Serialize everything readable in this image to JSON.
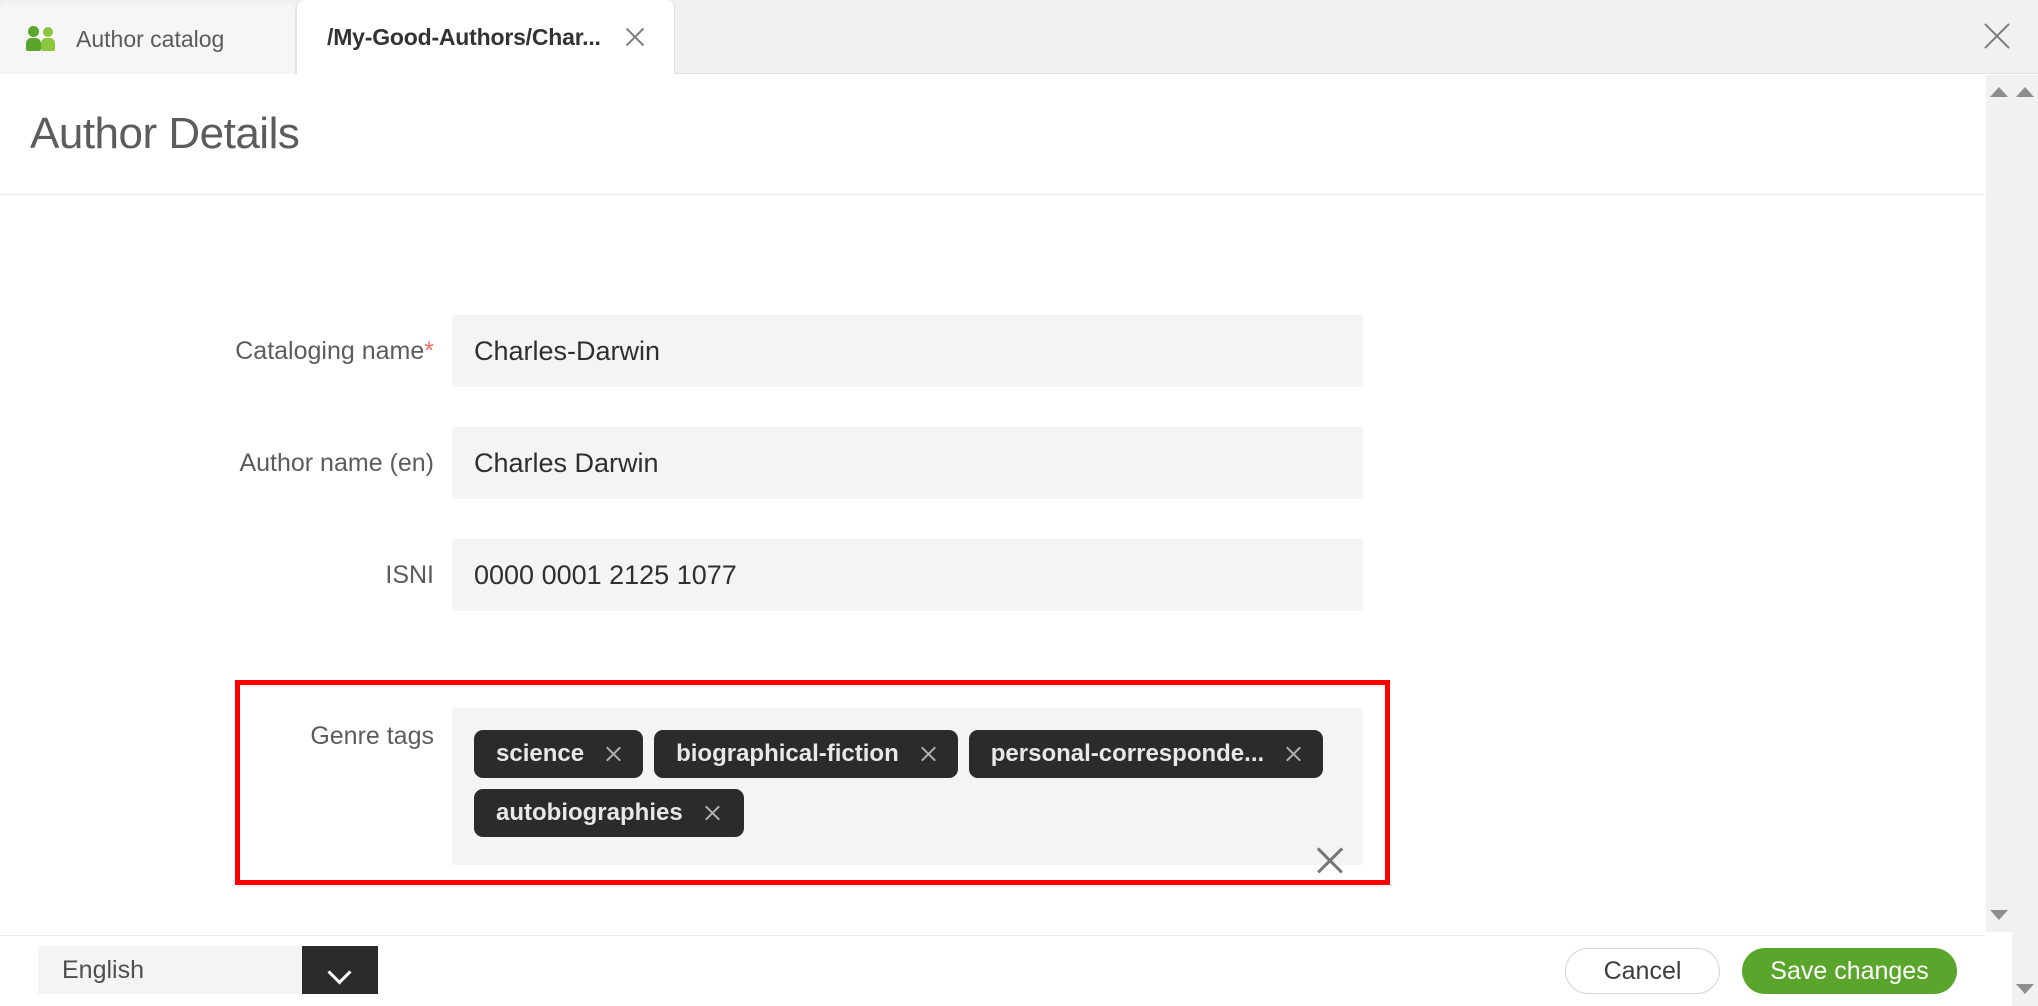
{
  "window": {
    "close_icon": "close-icon"
  },
  "tabs": [
    {
      "label": "Author catalog",
      "icon": "people-icon",
      "active": false,
      "closable": false
    },
    {
      "label": "/My-Good-Authors/Char...",
      "icon": null,
      "active": true,
      "closable": true
    }
  ],
  "page": {
    "title": "Author Details"
  },
  "form": {
    "fields": [
      {
        "label": "Cataloging name",
        "required": true,
        "required_marker": "*",
        "value": "Charles-Darwin"
      },
      {
        "label": "Author name (en)",
        "required": false,
        "value": "Charles Darwin"
      },
      {
        "label": "ISNI",
        "required": false,
        "value": "0000 0001 2125 1077"
      }
    ],
    "tags_field": {
      "label": "Genre tags",
      "tags": [
        "science",
        "biographical-fiction",
        "personal-corresponde...",
        "autobiographies"
      ],
      "remove_icon": "close-icon",
      "clear_all_icon": "clear-all-icon",
      "highlighted": true,
      "highlight_color": "#ff0000"
    }
  },
  "footer": {
    "language": {
      "selected": "English",
      "caret_icon": "chevron-down-icon"
    },
    "cancel_label": "Cancel",
    "save_label": "Save changes",
    "save_color": "#5aa52b"
  },
  "scrollbars": {
    "up_arrow_icon": "triangle-up-icon",
    "down_arrow_icon": "triangle-down-icon"
  }
}
